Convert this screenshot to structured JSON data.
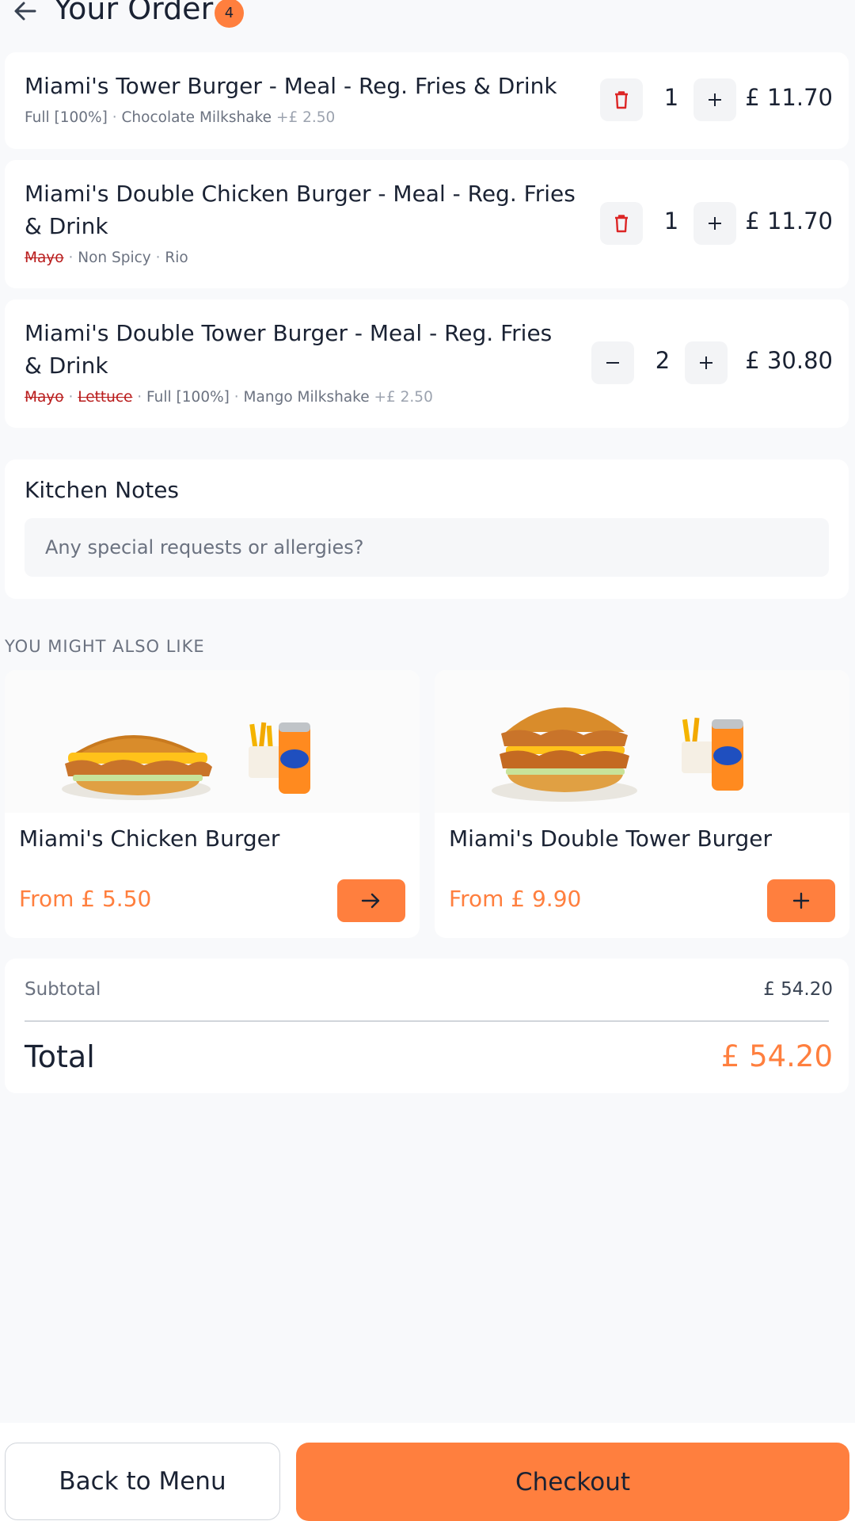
{
  "header": {
    "title": "Your Order",
    "badge_count": "4"
  },
  "cart_items": [
    {
      "name": "Miami's Tower Burger - Meal - Reg. Fries & Drink",
      "options": [
        {
          "text": "Full [100%]"
        },
        {
          "text": "Chocolate Milkshake",
          "extra": "+£ 2.50"
        }
      ],
      "quantity": "1",
      "price": "£ 11.70",
      "decrement_icon": "trash-icon"
    },
    {
      "name": "Miami's Double Chicken Burger - Meal - Reg. Fries & Drink",
      "options": [
        {
          "text": "Mayo",
          "removed": true
        },
        {
          "text": "Non Spicy"
        },
        {
          "text": "Rio"
        }
      ],
      "quantity": "1",
      "price": "£ 11.70",
      "decrement_icon": "trash-icon"
    },
    {
      "name": "Miami's Double Tower Burger - Meal - Reg. Fries & Drink",
      "options": [
        {
          "text": "Mayo",
          "removed": true
        },
        {
          "text": "Lettuce",
          "removed": true
        },
        {
          "text": "Full [100%]"
        },
        {
          "text": "Mango Milkshake",
          "extra": "+£ 2.50"
        }
      ],
      "quantity": "2",
      "price": "£ 30.80",
      "decrement_icon": "minus-icon"
    }
  ],
  "kitchen_notes": {
    "title": "Kitchen Notes",
    "placeholder": "Any special requests or allergies?",
    "value": ""
  },
  "recommendations": {
    "label": "YOU MIGHT ALSO LIKE",
    "items": [
      {
        "name": "Miami's Chicken Burger",
        "price": "From £ 5.50",
        "action_icon": "arrow-right-icon"
      },
      {
        "name": "Miami's Double Tower Burger",
        "price": "From £ 9.90",
        "action_icon": "plus-icon"
      }
    ]
  },
  "summary": {
    "subtotal_label": "Subtotal",
    "subtotal_value": "£ 54.20",
    "total_label": "Total",
    "total_value": "£ 54.20"
  },
  "footer": {
    "back_label": "Back to Menu",
    "checkout_label": "Checkout"
  },
  "colors": {
    "accent": "#ff7f3e",
    "danger": "#dc2626",
    "text": "#1a2233",
    "muted": "#6b7280",
    "background": "#f8f9fb"
  }
}
